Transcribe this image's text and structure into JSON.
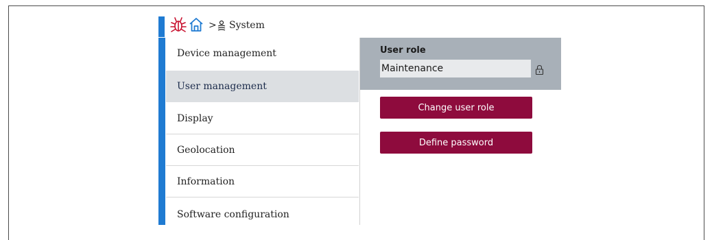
{
  "breadcrumb": {
    "separator": ">",
    "current": "System",
    "icons": [
      "bug-icon",
      "home-icon",
      "system-icon"
    ]
  },
  "menu": {
    "items": [
      {
        "label": "Device management"
      },
      {
        "label": "User management",
        "selected": true
      },
      {
        "label": "Display"
      },
      {
        "label": "Geolocation"
      },
      {
        "label": "Information"
      },
      {
        "label": "Software configuration"
      }
    ]
  },
  "user_role": {
    "label": "User role",
    "value": "Maintenance",
    "icon": "lock-icon"
  },
  "actions": {
    "change_role": "Change user role",
    "define_password": "Define password"
  },
  "colors": {
    "accent_blue": "#1f7bd2",
    "button_bg": "#8e0b3d",
    "panel_bg": "#a8b0b8",
    "selected_bg": "#dcdfe2",
    "icon_red": "#c8102e",
    "icon_blue": "#1f7bd2"
  }
}
